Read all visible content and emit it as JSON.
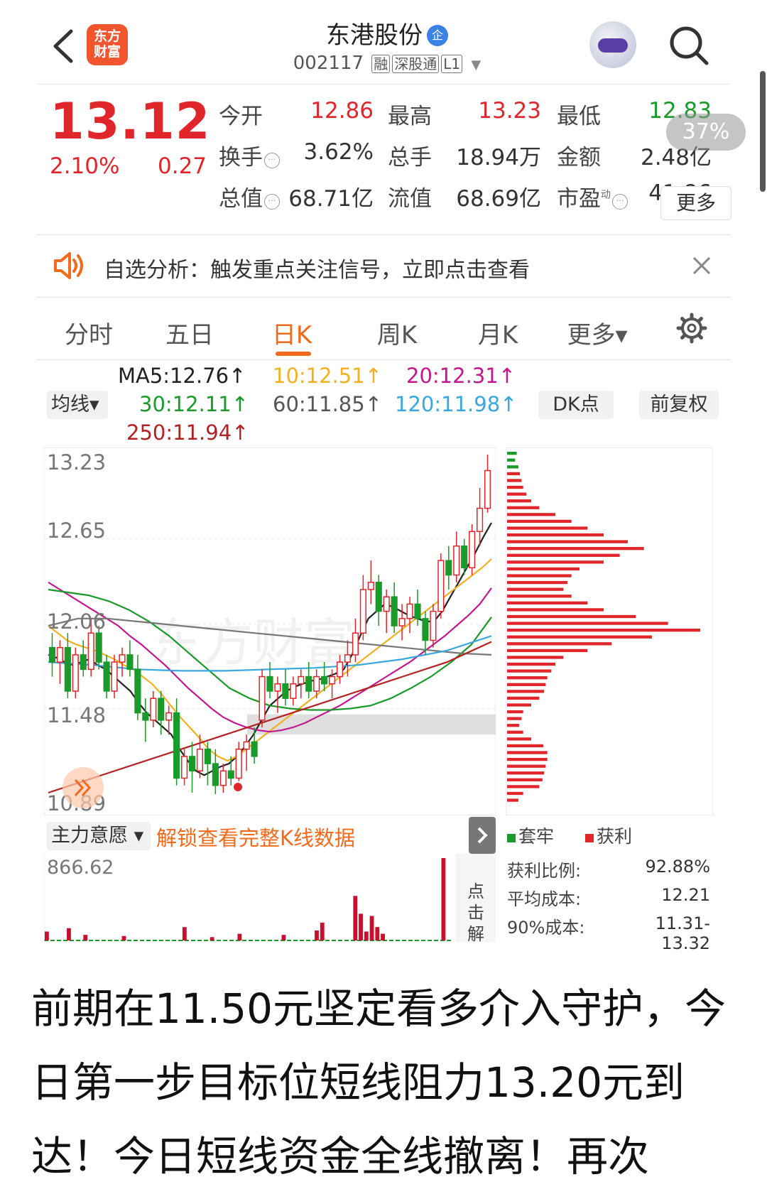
{
  "header": {
    "stock_name": "东港股份",
    "ent_badge": "企",
    "code": "002117",
    "tags": [
      "融",
      "深股通",
      "L1"
    ],
    "logo_text": "东方财富",
    "icons": [
      "back-icon",
      "robot-avatar",
      "search-icon"
    ]
  },
  "quote": {
    "price": "13.12",
    "change_pct": "2.10%",
    "change_abs": "0.27",
    "rows": [
      [
        {
          "label": "今开",
          "value": "12.86",
          "color": "red"
        },
        {
          "label": "最高",
          "value": "13.23",
          "color": "red"
        },
        {
          "label": "最低",
          "value": "12.83",
          "color": "green"
        }
      ],
      [
        {
          "label": "换手",
          "value": "3.62%",
          "color": "plain",
          "info": true
        },
        {
          "label": "总手",
          "value": "18.94万",
          "color": "plain"
        },
        {
          "label": "金额",
          "value": "2.48亿",
          "color": "plain"
        }
      ],
      [
        {
          "label": "总值",
          "value": "68.71亿",
          "color": "plain",
          "info": true
        },
        {
          "label": "流值",
          "value": "68.69亿",
          "color": "plain"
        },
        {
          "label": "市盈",
          "value": "41.86",
          "color": "plain",
          "info": true,
          "sup": "动"
        }
      ]
    ],
    "more_label": "更多",
    "pct_bubble": "37%"
  },
  "notice": {
    "text": "自选分析：触发重点关注信号，立即点击查看"
  },
  "tabs": [
    "分时",
    "五日",
    "日K",
    "周K",
    "月K",
    "更多▾"
  ],
  "active_tab": 2,
  "ma_legend": {
    "select_label": "均线▾",
    "items": [
      {
        "text": "MA5:12.76↑",
        "color": "#222222"
      },
      {
        "text": "10:12.51↑",
        "color": "#f2b022"
      },
      {
        "text": "20:12.31↑",
        "color": "#c2188f"
      },
      {
        "text": "30:12.11↑",
        "color": "#1a9a2a"
      },
      {
        "text": "60:11.85↑",
        "color": "#555555"
      },
      {
        "text": "120:11.98↑",
        "color": "#3aa8e0"
      },
      {
        "text": "250:11.94↑",
        "color": "#b22222"
      }
    ],
    "dk_label": "DK点",
    "fq_label": "前复权"
  },
  "chart": {
    "y_labels": [
      "13.23",
      "12.65",
      "12.06",
      "11.48",
      "10.89"
    ],
    "watermark": "东方财富"
  },
  "chart_data": {
    "type": "candlestick",
    "ylim": [
      10.89,
      13.23
    ],
    "candles": [
      {
        "o": 11.9,
        "h": 12.0,
        "l": 11.7,
        "c": 11.8
      },
      {
        "o": 11.8,
        "h": 11.95,
        "l": 11.65,
        "c": 11.9
      },
      {
        "o": 11.9,
        "h": 12.0,
        "l": 11.55,
        "c": 11.6
      },
      {
        "o": 11.6,
        "h": 11.9,
        "l": 11.55,
        "c": 11.85
      },
      {
        "o": 11.85,
        "h": 11.95,
        "l": 11.7,
        "c": 11.75
      },
      {
        "o": 11.75,
        "h": 12.1,
        "l": 11.7,
        "c": 12.0
      },
      {
        "o": 12.0,
        "h": 12.05,
        "l": 11.75,
        "c": 11.8
      },
      {
        "o": 11.8,
        "h": 11.85,
        "l": 11.55,
        "c": 11.6
      },
      {
        "o": 11.6,
        "h": 11.85,
        "l": 11.55,
        "c": 11.8
      },
      {
        "o": 11.8,
        "h": 11.9,
        "l": 11.7,
        "c": 11.85
      },
      {
        "o": 11.85,
        "h": 11.95,
        "l": 11.7,
        "c": 11.75
      },
      {
        "o": 11.75,
        "h": 11.85,
        "l": 11.4,
        "c": 11.45
      },
      {
        "o": 11.45,
        "h": 11.55,
        "l": 11.25,
        "c": 11.4
      },
      {
        "o": 11.4,
        "h": 11.6,
        "l": 11.35,
        "c": 11.55
      },
      {
        "o": 11.55,
        "h": 11.6,
        "l": 11.3,
        "c": 11.4
      },
      {
        "o": 11.4,
        "h": 11.5,
        "l": 11.3,
        "c": 11.45
      },
      {
        "o": 11.45,
        "h": 11.55,
        "l": 10.95,
        "c": 11.0
      },
      {
        "o": 11.0,
        "h": 11.2,
        "l": 10.95,
        "c": 11.15
      },
      {
        "o": 11.15,
        "h": 11.25,
        "l": 10.9,
        "c": 11.05
      },
      {
        "o": 11.05,
        "h": 11.3,
        "l": 11.0,
        "c": 11.2
      },
      {
        "o": 11.2,
        "h": 11.25,
        "l": 10.95,
        "c": 11.1
      },
      {
        "o": 11.1,
        "h": 11.2,
        "l": 10.89,
        "c": 10.95
      },
      {
        "o": 10.95,
        "h": 11.1,
        "l": 10.9,
        "c": 11.05
      },
      {
        "o": 11.05,
        "h": 11.15,
        "l": 10.95,
        "c": 11.0
      },
      {
        "o": 11.0,
        "h": 11.25,
        "l": 10.98,
        "c": 11.2
      },
      {
        "o": 11.2,
        "h": 11.3,
        "l": 11.05,
        "c": 11.25
      },
      {
        "o": 11.25,
        "h": 11.35,
        "l": 11.1,
        "c": 11.15
      },
      {
        "o": 11.4,
        "h": 11.75,
        "l": 11.35,
        "c": 11.7
      },
      {
        "o": 11.7,
        "h": 11.8,
        "l": 11.55,
        "c": 11.6
      },
      {
        "o": 11.6,
        "h": 11.7,
        "l": 11.45,
        "c": 11.65
      },
      {
        "o": 11.65,
        "h": 11.75,
        "l": 11.5,
        "c": 11.55
      },
      {
        "o": 11.55,
        "h": 11.7,
        "l": 11.5,
        "c": 11.65
      },
      {
        "o": 11.65,
        "h": 11.75,
        "l": 11.55,
        "c": 11.7
      },
      {
        "o": 11.7,
        "h": 11.8,
        "l": 11.55,
        "c": 11.6
      },
      {
        "o": 11.6,
        "h": 11.75,
        "l": 11.55,
        "c": 11.7
      },
      {
        "o": 11.7,
        "h": 11.8,
        "l": 11.6,
        "c": 11.65
      },
      {
        "o": 11.65,
        "h": 11.75,
        "l": 11.55,
        "c": 11.7
      },
      {
        "o": 11.7,
        "h": 11.85,
        "l": 11.65,
        "c": 11.8
      },
      {
        "o": 11.8,
        "h": 11.95,
        "l": 11.7,
        "c": 11.85
      },
      {
        "o": 11.85,
        "h": 12.1,
        "l": 11.8,
        "c": 12.0
      },
      {
        "o": 12.0,
        "h": 12.4,
        "l": 11.95,
        "c": 12.3
      },
      {
        "o": 12.3,
        "h": 12.5,
        "l": 12.2,
        "c": 12.35
      },
      {
        "o": 12.35,
        "h": 12.4,
        "l": 12.05,
        "c": 12.15
      },
      {
        "o": 12.15,
        "h": 12.3,
        "l": 12.0,
        "c": 12.25
      },
      {
        "o": 12.25,
        "h": 12.35,
        "l": 12.0,
        "c": 12.05
      },
      {
        "o": 12.05,
        "h": 12.2,
        "l": 11.95,
        "c": 12.1
      },
      {
        "o": 12.1,
        "h": 12.25,
        "l": 12.0,
        "c": 12.2
      },
      {
        "o": 12.2,
        "h": 12.3,
        "l": 12.05,
        "c": 12.1
      },
      {
        "o": 12.1,
        "h": 12.15,
        "l": 11.85,
        "c": 11.95
      },
      {
        "o": 11.95,
        "h": 12.2,
        "l": 11.9,
        "c": 12.15
      },
      {
        "o": 12.15,
        "h": 12.55,
        "l": 12.1,
        "c": 12.5
      },
      {
        "o": 12.5,
        "h": 12.6,
        "l": 12.3,
        "c": 12.4
      },
      {
        "o": 12.4,
        "h": 12.7,
        "l": 12.35,
        "c": 12.6
      },
      {
        "o": 12.6,
        "h": 12.65,
        "l": 12.4,
        "c": 12.45
      },
      {
        "o": 12.45,
        "h": 12.75,
        "l": 12.4,
        "c": 12.7
      },
      {
        "o": 12.7,
        "h": 13.0,
        "l": 12.6,
        "c": 12.86
      },
      {
        "o": 12.86,
        "h": 13.23,
        "l": 12.83,
        "c": 13.12
      }
    ],
    "ma_lines": {
      "MA5": [
        11.85,
        11.83,
        11.8,
        11.78,
        11.8,
        11.82,
        11.78,
        11.75,
        11.7,
        11.65,
        11.6,
        11.52,
        11.45,
        11.4,
        11.35,
        11.3,
        11.2,
        11.12,
        11.05,
        11.02,
        11.05,
        11.08,
        11.1,
        11.15,
        11.22,
        11.3,
        11.4,
        11.5,
        11.55,
        11.6,
        11.63,
        11.65,
        11.67,
        11.68,
        11.7,
        11.72,
        11.75,
        11.85,
        11.98,
        12.1,
        12.15,
        12.2,
        12.18,
        12.15,
        12.12,
        12.1,
        12.08,
        12.08,
        12.15,
        12.25,
        12.35,
        12.45,
        12.55,
        12.66,
        12.76
      ],
      "MA10": [
        12.05,
        12.0,
        11.95,
        11.92,
        11.9,
        11.88,
        11.85,
        11.82,
        11.78,
        11.75,
        11.7,
        11.65,
        11.58,
        11.5,
        11.42,
        11.35,
        11.28,
        11.2,
        11.15,
        11.12,
        11.15,
        11.2,
        11.25,
        11.3,
        11.35,
        11.4,
        11.45,
        11.5,
        11.55,
        11.6,
        11.65,
        11.7,
        11.75,
        11.8,
        11.85,
        11.9,
        11.95,
        12.0,
        12.05,
        12.1,
        12.15,
        12.2,
        12.25,
        12.3,
        12.35,
        12.4,
        12.45,
        12.51
      ],
      "MA20": [
        12.35,
        12.3,
        12.25,
        12.2,
        12.15,
        12.1,
        12.05,
        11.98,
        11.92,
        11.85,
        11.78,
        11.7,
        11.62,
        11.55,
        11.48,
        11.42,
        11.38,
        11.35,
        11.33,
        11.32,
        11.33,
        11.35,
        11.38,
        11.42,
        11.46,
        11.5,
        11.55,
        11.6,
        11.65,
        11.7,
        11.75,
        11.8,
        11.86,
        11.92,
        11.98,
        12.05,
        12.12,
        12.2,
        12.31
      ],
      "MA30": [
        12.3,
        12.28,
        12.26,
        12.22,
        12.16,
        12.08,
        11.98,
        11.86,
        11.74,
        11.62,
        11.55,
        11.5,
        11.48,
        11.47,
        11.47,
        11.48,
        11.5,
        11.55,
        11.62,
        11.7,
        11.8,
        11.92,
        12.11
      ],
      "MA60": [
        12.05,
        12.1,
        12.1,
        12.08,
        12.06,
        12.04,
        12.02,
        12.0,
        11.98,
        11.96,
        11.94,
        11.92,
        11.9,
        11.88,
        11.86,
        11.85
      ],
      "MA120": [
        11.8,
        11.78,
        11.75,
        11.74,
        11.74,
        11.75,
        11.76,
        11.78,
        11.82,
        11.88,
        11.98
      ],
      "MA250": [
        10.9,
        11.0,
        11.1,
        11.2,
        11.3,
        11.4,
        11.5,
        11.6,
        11.7,
        11.8,
        11.94
      ]
    },
    "volume_ylabel": "866.62",
    "volumes": [
      40,
      0,
      0,
      0,
      55,
      0,
      0,
      25,
      0,
      0,
      0,
      0,
      0,
      0,
      20,
      0,
      0,
      0,
      0,
      0,
      0,
      0,
      0,
      0,
      0,
      60,
      0,
      0,
      0,
      0,
      15,
      0,
      0,
      0,
      0,
      30,
      0,
      0,
      0,
      0,
      0,
      0,
      0,
      25,
      0,
      0,
      0,
      0,
      0,
      45,
      80,
      0,
      0,
      0,
      0,
      0,
      200,
      120,
      40,
      110,
      60,
      30,
      0,
      0,
      0,
      0,
      0,
      0,
      0,
      0,
      0,
      0,
      370,
      0
    ],
    "profile": [
      12,
      10,
      14,
      16,
      18,
      20,
      24,
      30,
      40,
      60,
      80,
      100,
      120,
      150,
      170,
      140,
      120,
      90,
      80,
      75,
      70,
      80,
      100,
      120,
      160,
      200,
      240,
      180,
      130,
      100,
      70,
      60,
      55,
      50,
      48,
      46,
      40,
      30,
      20,
      18,
      15,
      20,
      30,
      45,
      50,
      50,
      48,
      46,
      44,
      40,
      20,
      14
    ],
    "profile_green_count": 3
  },
  "lower": {
    "main_select": "主力意愿",
    "unlock_text": "解锁查看完整K线数据",
    "click_text": [
      "点",
      "击",
      "解"
    ],
    "legend": [
      {
        "label": "套牢",
        "color": "#1a9a2a"
      },
      {
        "label": "获利",
        "color": "#e0262b"
      }
    ],
    "stats": [
      {
        "label": "获利比例:",
        "value": "92.88%"
      },
      {
        "label": "平均成本:",
        "value": "12.21"
      },
      {
        "label": "90%成本:",
        "value": "11.31-13.32"
      }
    ]
  },
  "caption": "前期在11.50元坚定看多介入守护，今日第一步目标位短线阻力13.20元到达！今日短线资金全线撤离！再次"
}
